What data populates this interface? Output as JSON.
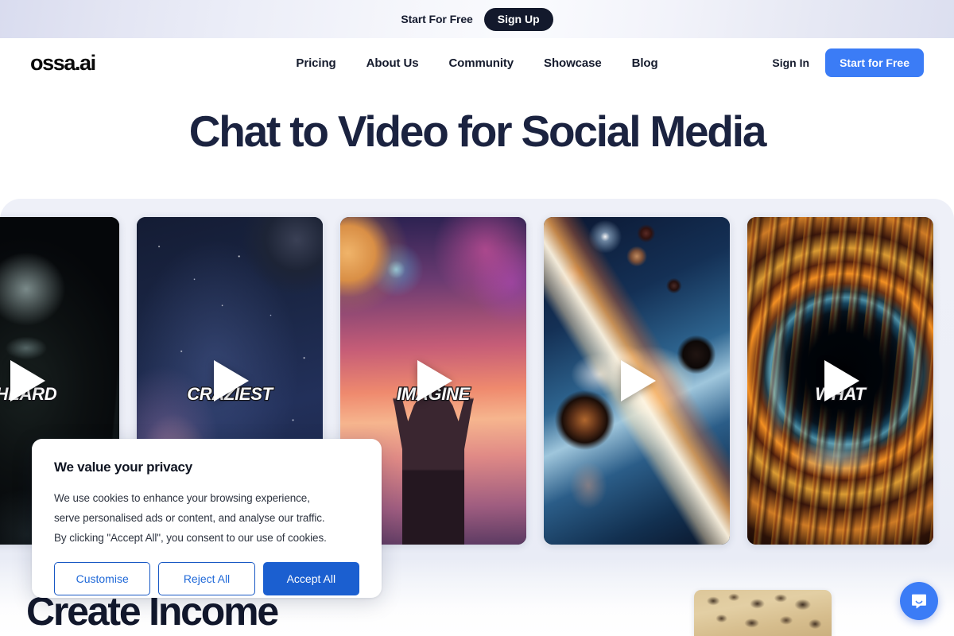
{
  "promo_banner": {
    "text": "Start For Free",
    "signup_label": "Sign Up"
  },
  "navbar": {
    "brand": "ossa.ai",
    "links": [
      {
        "label": "Pricing"
      },
      {
        "label": "About Us"
      },
      {
        "label": "Community"
      },
      {
        "label": "Showcase"
      },
      {
        "label": "Blog"
      }
    ],
    "signin_label": "Sign In",
    "cta_label": "Start for Free",
    "cta_color": "#3b7cf6"
  },
  "hero": {
    "title": "Chat to Video for Social Media"
  },
  "showcase": {
    "cards": [
      {
        "caption": "HEARD",
        "art": "art-corridor",
        "icon": "play-icon"
      },
      {
        "caption": "CRAZIEST",
        "art": "art-galaxy",
        "icon": "play-icon"
      },
      {
        "caption": "IMAGINE",
        "art": "art-imagine",
        "icon": "play-icon"
      },
      {
        "caption": "",
        "art": "art-space",
        "icon": "play-icon"
      },
      {
        "caption": "WHAT",
        "art": "art-blackhole",
        "icon": "play-icon"
      }
    ]
  },
  "next_section": {
    "title": "Create Income"
  },
  "cookie_consent": {
    "title": "We value your privacy",
    "body_line_1": "We use cookies to enhance your browsing experience,",
    "body_line_2": "serve personalised ads or content, and analyse our traffic.",
    "body_line_3": "By clicking \"Accept All\", you consent to our use of cookies.",
    "customise_label": "Customise",
    "reject_label": "Reject All",
    "accept_label": "Accept All",
    "accent_color": "#1b5fd0"
  },
  "chat_widget": {
    "icon": "chat-bubble-icon",
    "color": "#3b7cf6"
  }
}
